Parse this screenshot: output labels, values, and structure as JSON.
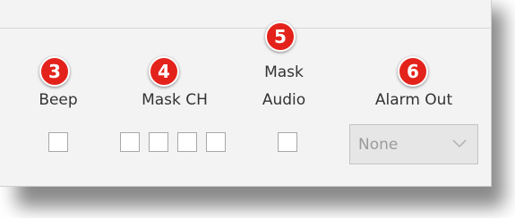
{
  "columns": {
    "beep": {
      "badge": "3",
      "label": "Beep"
    },
    "mask_ch": {
      "badge": "4",
      "label": "Mask CH"
    },
    "mask_audio": {
      "badge": "5",
      "label_line1": "Mask",
      "label_line2": "Audio"
    },
    "alarm_out": {
      "badge": "6",
      "label": "Alarm Out",
      "selected": "None"
    }
  },
  "colors": {
    "badge": "#e3231b",
    "panel": "#f3f3f3",
    "select_bg": "#e6e6e6"
  },
  "icons": {
    "dropdown": "chevron-down-icon"
  }
}
